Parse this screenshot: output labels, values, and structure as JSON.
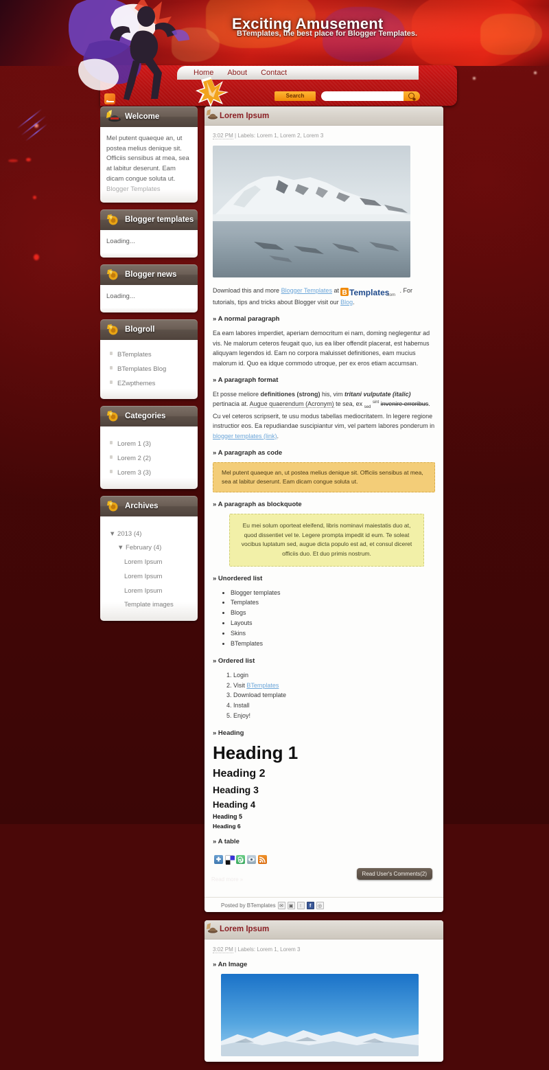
{
  "site": {
    "title": "Exciting Amusement",
    "subtitle": "BTemplates, the best place for Blogger Templates."
  },
  "nav": {
    "items": [
      "Home",
      "About",
      "Contact"
    ]
  },
  "search": {
    "button_label": "Search",
    "value": "",
    "placeholder": ""
  },
  "sidebar": {
    "widgets": [
      {
        "title": "Welcome",
        "icon": "hat-icon",
        "type": "text",
        "text": "Mel putent quaeque an, ut postea melius denique sit. Officiis sensibus at mea, sea at labitur deserunt. Eam dicam congue soluta ut.",
        "link": "Blogger Templates"
      },
      {
        "title": "Blogger templates",
        "icon": "star-icon",
        "type": "loading",
        "text": "Loading..."
      },
      {
        "title": "Blogger news",
        "icon": "star-icon",
        "type": "loading",
        "text": "Loading..."
      },
      {
        "title": "Blogroll",
        "icon": "star-icon",
        "type": "list",
        "items": [
          "BTemplates",
          "BTemplates Blog",
          "EZwpthemes"
        ]
      },
      {
        "title": "Categories",
        "icon": "star-icon",
        "type": "list",
        "items": [
          "Lorem 1 (3)",
          "Lorem 2 (2)",
          "Lorem 3 (3)"
        ]
      },
      {
        "title": "Archives",
        "icon": "star-icon",
        "type": "archive",
        "items": [
          {
            "label": "▼ 2013 (4)",
            "level": 1
          },
          {
            "label": "▼ February (4)",
            "level": 2
          },
          {
            "label": "Lorem Ipsum",
            "level": 3
          },
          {
            "label": "Lorem Ipsum",
            "level": 3
          },
          {
            "label": "Lorem Ipsum",
            "level": 3
          },
          {
            "label": "Template images",
            "level": 3
          }
        ]
      }
    ]
  },
  "posts": [
    {
      "title": "Lorem Ipsum",
      "time": "3:02 PM",
      "meta_labels": "| Labels: Lorem 1, Lorem 2, Lorem 3",
      "intro_a": "Download this and more ",
      "intro_link1": "Blogger Templates",
      "intro_b": " at ",
      "brand": "Templates",
      "brand_tld": ".com",
      "intro_c": ". For tutorials, tips and tricks about Blogger visit our ",
      "intro_link2": "Blog",
      "intro_d": ".",
      "sections": {
        "normal_paragraph_heading": "» A normal paragraph",
        "normal_paragraph": "Ea eam labores imperdiet, aperiam democritum ei nam, doming neglegentur ad vis. Ne malorum ceteros feugait quo, ius ea liber offendit placerat, est habemus aliquyam legendos id. Eam no corpora maluisset definitiones, eam mucius malorum id. Quo ea idque commodo utroque, per ex eros etiam accumsan.",
        "format_heading": "» A paragraph format",
        "format_a": "Et posse meliore ",
        "format_strong": "definitiones (strong)",
        "format_b": " his, vim ",
        "format_italic": "tritani vulputate (italic)",
        "format_c": " pertinacia at. ",
        "format_acronym": "Augue quaerendum (Acronym)",
        "format_d": " te sea, ex ",
        "format_sub": "sed",
        "format_sup": "sint",
        "format_strike": "invenire erroribus",
        "format_e": ". Cu vel ceteros scripserit, te usu modus tabellas mediocritatem. In legere regione instructior eos. Ea repudiandae suscipiantur vim, vel partem labores ponderum in ",
        "format_link": "blogger templates (link)",
        "format_f": ".",
        "code_heading": "» A paragraph as code",
        "code_text": "Mel putent quaeque an, ut postea melius denique sit. Officiis sensibus at mea, sea at labitur deserunt. Eam dicam congue soluta ut.",
        "quote_heading": "» A paragraph as blockquote",
        "quote_text": "Eu mei solum oporteat eleifend, libris nominavi maiestatis duo at, quod dissentiet vel te. Legere prompta impedit id eum. Te soleat vocibus luptatum sed, augue dicta populo est ad, et consul diceret officiis duo. Et duo primis nostrum.",
        "ul_heading": "» Unordered list",
        "ul_items": [
          "Blogger templates",
          "Templates",
          "Blogs",
          "Layouts",
          "Skins",
          "BTemplates"
        ],
        "ol_heading": "» Ordered list",
        "ol_items": [
          "Login",
          "Visit BTemplates",
          "Download template",
          "Install",
          "Enjoy!"
        ],
        "ol_link_text": "BTemplates",
        "heading_heading": "» Heading",
        "h1": "Heading 1",
        "h2": "Heading 2",
        "h3": "Heading 3",
        "h4": "Heading 4",
        "h5": "Heading 5",
        "h6": "Heading 6",
        "table_heading": "» A table"
      },
      "share_icons": [
        "addthis-icon",
        "delicious-icon",
        "stumbleupon-icon",
        "digg-icon",
        "rss-icon"
      ],
      "comments_button": "Read User's Comments(2)",
      "read_more": "Read more »",
      "footer_text": "Posted by BTemplates",
      "footer_icons": [
        "email-icon",
        "blogthis-icon",
        "twitter-icon",
        "facebook-icon",
        "pinterest-icon"
      ]
    },
    {
      "title": "Lorem Ipsum",
      "time": "3:02 PM",
      "meta_labels": "| Labels: Lorem 1, Lorem 3",
      "image_heading": "» An Image"
    }
  ],
  "colors": {
    "page_bg": "#450707",
    "header_red": "#c21a12",
    "nav_red": "#b51111",
    "widget_head": "#5c5048",
    "post_title": "#8a1f24",
    "link": "#6ca6d9",
    "code_bg": "#f3cd78",
    "quote_bg": "#f2f0a8",
    "accent_orange": "#f08a09"
  }
}
